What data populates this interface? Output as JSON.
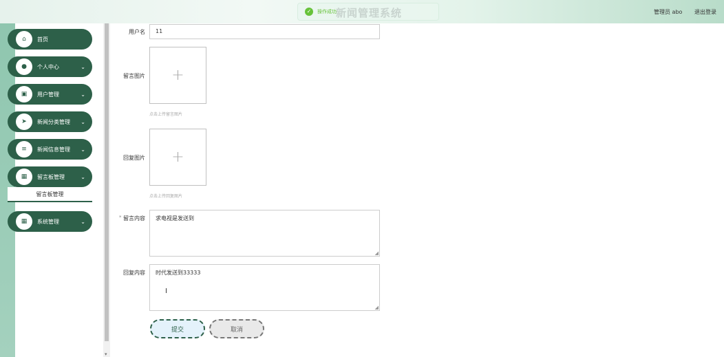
{
  "header": {
    "title": "新闻管理系统",
    "toast": "操作成功",
    "user": "管理员 abo",
    "logout": "退出登录"
  },
  "sidebar": {
    "items": [
      {
        "label": "首页",
        "icon": "home-icon",
        "glyph": "⌂",
        "has_submenu": false
      },
      {
        "label": "个人中心",
        "icon": "user-icon",
        "glyph": "●",
        "has_submenu": true
      },
      {
        "label": "用户管理",
        "icon": "chart-icon",
        "glyph": "▣",
        "has_submenu": true
      },
      {
        "label": "新闻分类管理",
        "icon": "send-icon",
        "glyph": "➤",
        "has_submenu": true
      },
      {
        "label": "新闻信息管理",
        "icon": "list-icon",
        "glyph": "≡",
        "has_submenu": true
      },
      {
        "label": "留言板管理",
        "icon": "grid-icon",
        "glyph": "▦",
        "has_submenu": true
      },
      {
        "label": "系统管理",
        "icon": "grid-icon",
        "glyph": "▦",
        "has_submenu": true
      }
    ],
    "active_submenu": "留言板管理",
    "chevron": "⌄"
  },
  "form": {
    "username_label": "用户名",
    "username_value": "11",
    "message_image_label": "留言图片",
    "message_image_hint": "点击上传留言图片",
    "reply_image_label": "回复图片",
    "reply_image_hint": "点击上传回复图片",
    "message_content_label": "留言内容",
    "message_content_value": "求电视是发送到",
    "reply_content_label": "回复内容",
    "reply_content_value": "时代发送到33333",
    "plus": "+",
    "submit_label": "提交",
    "cancel_label": "取消"
  },
  "colors": {
    "primary": "#2d6049",
    "rail": "#a4d1be",
    "toast_green": "#67c23a"
  }
}
